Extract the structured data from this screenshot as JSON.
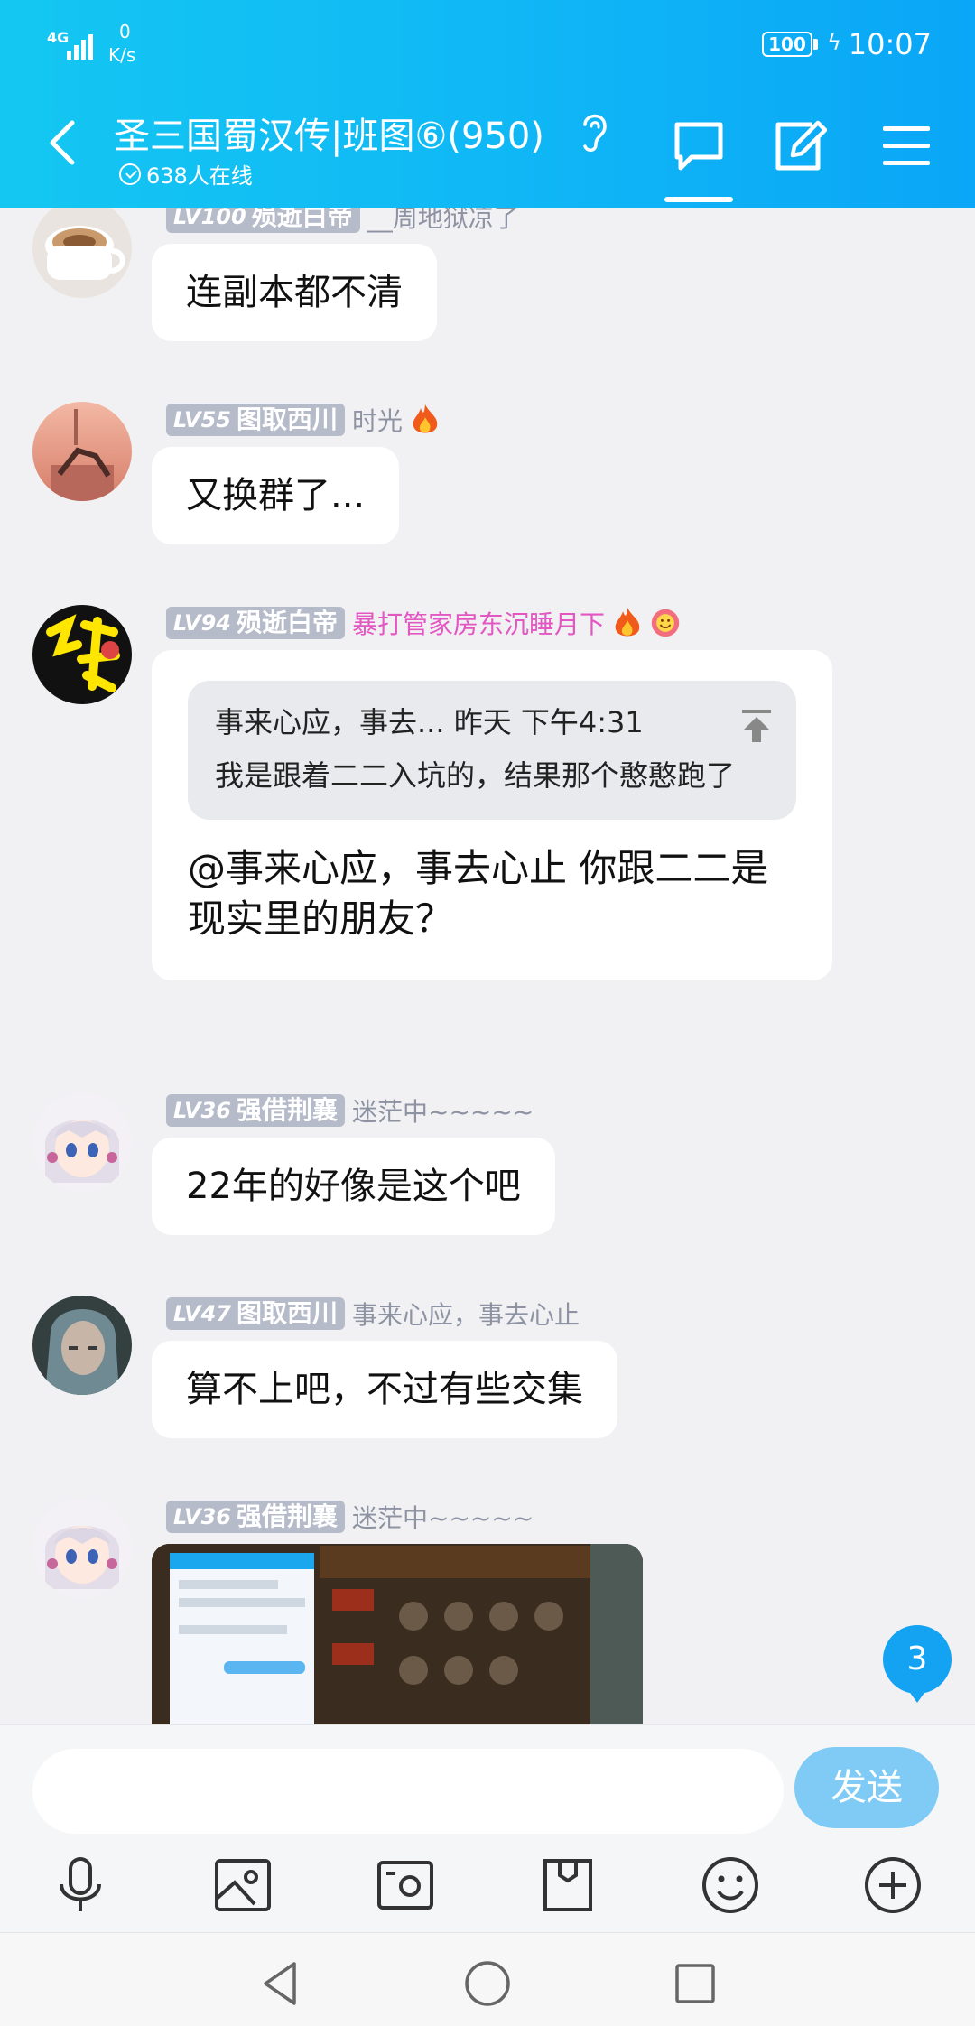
{
  "status_bar": {
    "network": "4G",
    "speed_value": "0",
    "speed_unit": "K/s",
    "battery": "100",
    "time": "10:07"
  },
  "header": {
    "title": "圣三国蜀汉传|班图⑥(950)",
    "online": "638人在线",
    "icons": [
      "back-icon",
      "ear-icon",
      "chat-icon",
      "edit-icon",
      "menu-icon"
    ]
  },
  "messages": [
    {
      "level": "LV100",
      "title": "殒逝白帝",
      "nick": "__周地狱凉了",
      "text": "连副本都不清"
    },
    {
      "level": "LV55",
      "title": "图取西川",
      "nick": "时光",
      "text": "又换群了..."
    },
    {
      "level": "LV94",
      "title": "殒逝白帝",
      "nick": "暴打管家房东沉睡月下",
      "quote_head": "事来心应，事去... 昨天 下午4:31",
      "quote_body": "我是跟着二二入坑的，结果那个憨憨跑了",
      "text": "@事来心应，事去心止 你跟二二是现实里的朋友？"
    },
    {
      "level": "LV36",
      "title": "强借荆襄",
      "nick": "迷茫中~~~~~",
      "text": "22年的好像是这个吧"
    },
    {
      "level": "LV47",
      "title": "图取西川",
      "nick": "事来心应，事去心止",
      "text": "算不上吧，不过有些交集"
    },
    {
      "level": "LV36",
      "title": "强借荆襄",
      "nick": "迷茫中~~~~~",
      "image": "game screenshot"
    }
  ],
  "unread_count": "3",
  "input": {
    "placeholder": "",
    "send_label": "发送",
    "tools": [
      "mic-icon",
      "image-icon",
      "camera-icon",
      "file-icon",
      "emoji-icon",
      "plus-icon"
    ]
  },
  "colors": {
    "header_start": "#14c7f2",
    "header_end": "#0aa6f7",
    "accent": "#14a3f3",
    "send_disabled": "#7fcbf5",
    "badge": "#b6bbc9",
    "pink_nick": "#e357c2"
  }
}
